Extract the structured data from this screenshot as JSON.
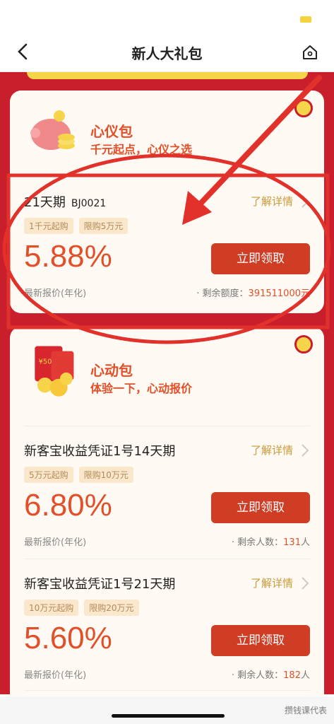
{
  "nav": {
    "title": "新人大礼包"
  },
  "colors": {
    "accent": "#e2502a",
    "button": "#cf3d25",
    "background": "#c91f2c",
    "gold": "#f6d54a"
  },
  "packs": [
    {
      "title": "心仪包",
      "subtitle": "千元起点，心仪之选",
      "products": [
        {
          "name": "21天期",
          "code": "BJ0021",
          "detail": "了解详情",
          "tag1": "1千元起购",
          "tag2": "限购5万元",
          "rate": "5.88%",
          "button": "立即领取",
          "rate_label": "最新报价(年化)",
          "remain_label": "剩余额度：",
          "remain_value": "391511000元"
        }
      ]
    },
    {
      "title": "心动包",
      "subtitle": "体验一下，心动报价",
      "icon_text": "¥50",
      "products": [
        {
          "name": "新客宝收益凭证1号14天期",
          "detail": "了解详情",
          "tag1": "5万元起购",
          "tag2": "限购10万元",
          "rate": "6.80%",
          "button": "立即领取",
          "rate_label": "最新报价(年化)",
          "remain_label": "剩余人数：",
          "remain_value": "131",
          "remain_unit": "人"
        },
        {
          "name": "新客宝收益凭证1号21天期",
          "detail": "了解详情",
          "tag1": "10万元起购",
          "tag2": "限购20万元",
          "rate": "5.60%",
          "button": "立即领取",
          "rate_label": "最新报价(年化)",
          "remain_label": "剩余人数：",
          "remain_value": "182",
          "remain_unit": "人"
        }
      ]
    }
  ],
  "watermark": "攒钱课代表"
}
